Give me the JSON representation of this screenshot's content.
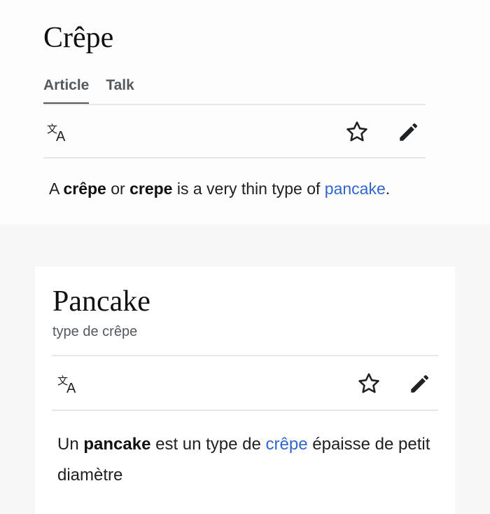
{
  "page1": {
    "title": "Crêpe",
    "tabs": [
      {
        "label": "Article",
        "active": true
      },
      {
        "label": "Talk",
        "active": false
      }
    ],
    "toolbar": {
      "language_icon": "translate-icon",
      "watch_icon": "star-icon",
      "edit_icon": "pencil-icon"
    },
    "text": {
      "part1": "A ",
      "bold1": "crêpe",
      "part2": " or ",
      "bold2": "crepe",
      "part3": " is a very thin type of ",
      "link": "pancake",
      "part4": "."
    }
  },
  "page2": {
    "title": "Pancake",
    "subtitle": "type de crêpe",
    "toolbar": {
      "language_icon": "translate-icon",
      "watch_icon": "star-icon",
      "edit_icon": "pencil-icon"
    },
    "text": {
      "part1": "Un ",
      "bold1": "pancake",
      "part2": " est un type de ",
      "link": "crêpe",
      "part3": " épaisse de petit diamètre"
    }
  },
  "colors": {
    "link": "#3366cc",
    "text": "#202122",
    "muted": "#54595d",
    "divider": "#e6e7e8"
  }
}
